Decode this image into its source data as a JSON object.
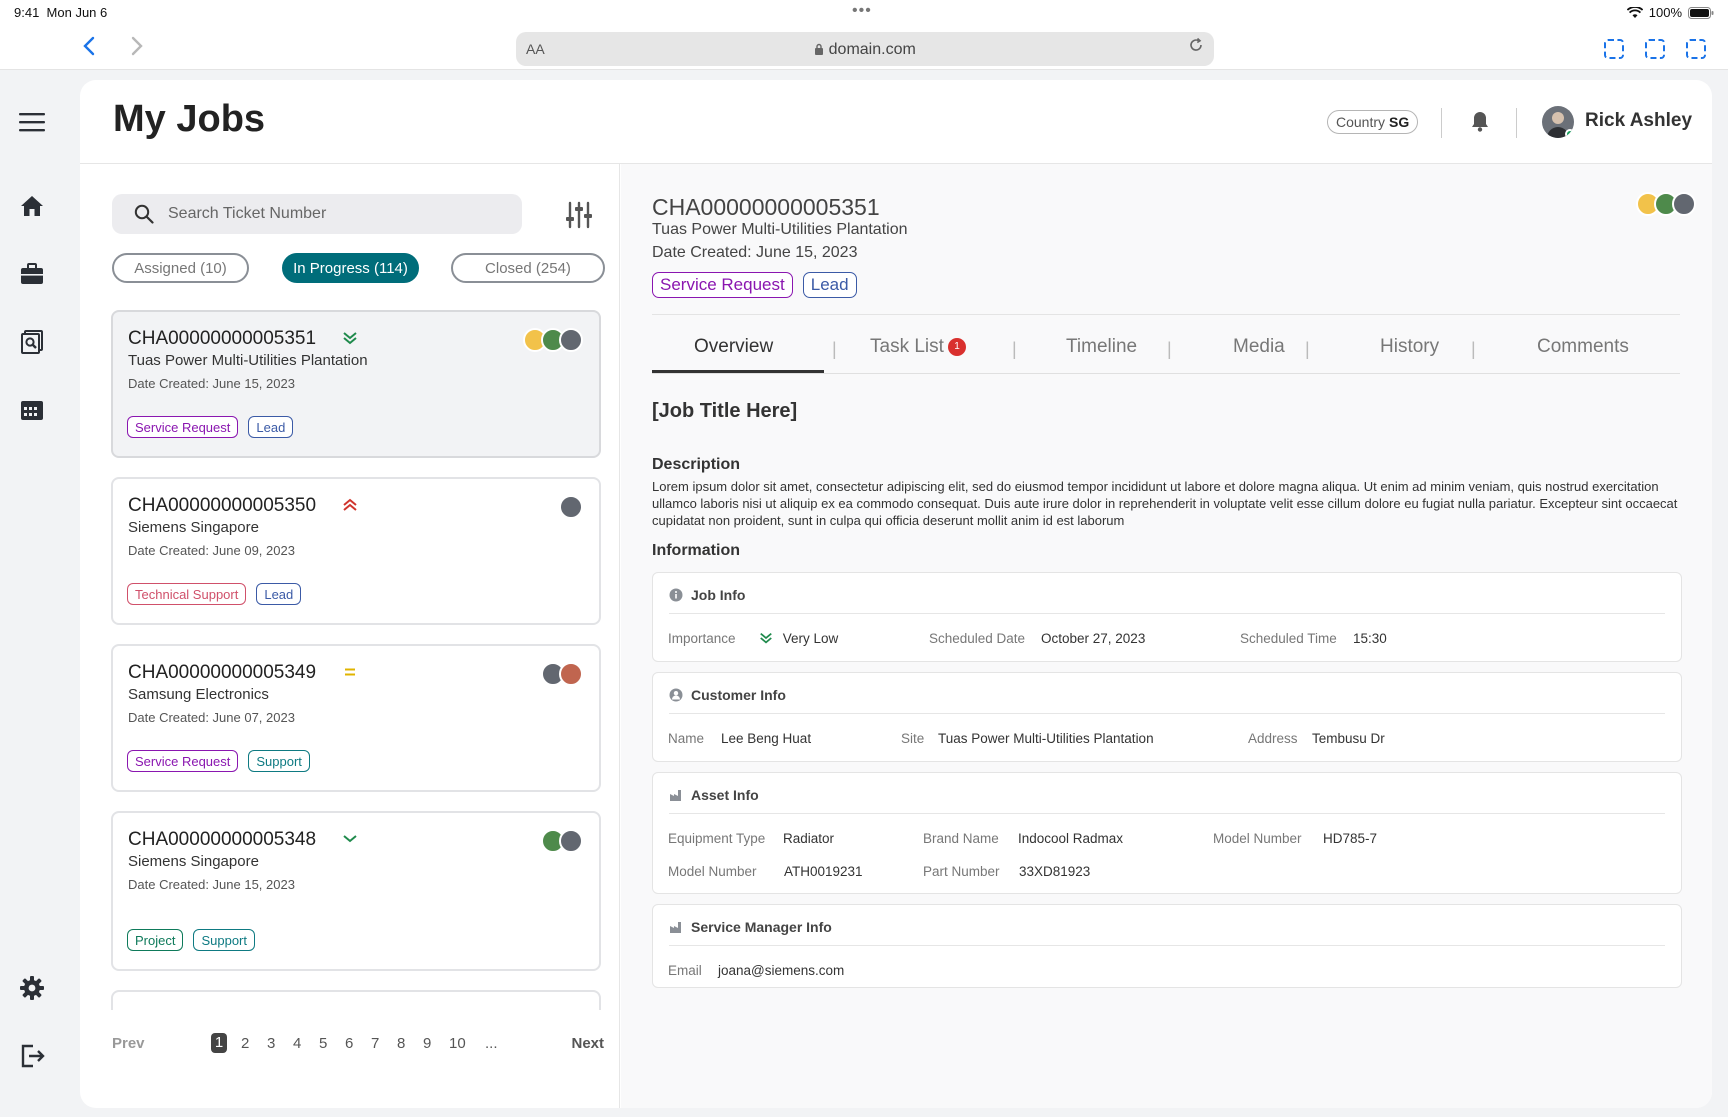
{
  "statusbar": {
    "time": "9:41",
    "date": "Mon Jun 6",
    "battery": "100%"
  },
  "browser": {
    "aa": "AA",
    "url": "domain.com"
  },
  "header": {
    "title": "My Jobs",
    "country_label": "Country",
    "country_value": "SG",
    "user_name": "Rick Ashley"
  },
  "search": {
    "placeholder": "Search Ticket Number"
  },
  "filters": [
    {
      "label": "Assigned (10)"
    },
    {
      "label": "In Progress (114)"
    },
    {
      "label": "Closed (254)"
    }
  ],
  "jobs": [
    {
      "id": "CHA00000000005351",
      "priority": "very-low",
      "company": "Tuas Power Multi-Utilities Plantation",
      "date": "Date Created: June 15, 2023",
      "tags": [
        "Service Request",
        "Lead"
      ]
    },
    {
      "id": "CHA00000000005350",
      "priority": "very-high",
      "company": "Siemens Singapore",
      "date": "Date Created: June 09, 2023",
      "tags": [
        "Technical Support",
        "Lead"
      ]
    },
    {
      "id": "CHA00000000005349",
      "priority": "medium",
      "company": "Samsung Electronics",
      "date": "Date Created: June 07, 2023",
      "tags": [
        "Service Request",
        "Support"
      ]
    },
    {
      "id": "CHA00000000005348",
      "priority": "low",
      "company": "Siemens Singapore",
      "date": "Date Created: June 15, 2023",
      "tags": [
        "Project",
        "Support"
      ]
    }
  ],
  "pagination": {
    "prev": "Prev",
    "next": "Next",
    "pages": [
      "1",
      "2",
      "3",
      "4",
      "5",
      "6",
      "7",
      "8",
      "9",
      "10",
      "..."
    ],
    "current": "1"
  },
  "detail": {
    "id": "CHA00000000005351",
    "company": "Tuas Power Multi-Utilities Plantation",
    "date": "Date Created: June 15, 2023",
    "tags": [
      "Service Request",
      "Lead"
    ],
    "tabs": [
      "Overview",
      "Task List",
      "Timeline",
      "Media",
      "History",
      "Comments"
    ],
    "task_badge": "1",
    "job_title": "[Job Title Here]",
    "description_heading": "Description",
    "description": "Lorem ipsum dolor sit amet, consectetur adipiscing elit, sed do eiusmod tempor incididunt ut labore et dolore magna aliqua. Ut enim ad minim veniam, quis nostrud exercitation ullamco laboris nisi ut aliquip ex ea commodo consequat. Duis aute irure dolor in reprehenderit in voluptate velit esse cillum dolore eu fugiat nulla pariatur. Excepteur sint occaecat cupidatat non proident, sunt in culpa qui officia deserunt mollit anim id est laborum",
    "information_heading": "Information",
    "job_info": {
      "heading": "Job Info",
      "importance_label": "Importance",
      "importance_value": "Very Low",
      "sched_date_label": "Scheduled Date",
      "sched_date_value": "October 27, 2023",
      "sched_time_label": "Scheduled Time",
      "sched_time_value": "15:30"
    },
    "customer_info": {
      "heading": "Customer Info",
      "name_label": "Name",
      "name_value": "Lee Beng Huat",
      "site_label": "Site",
      "site_value": "Tuas Power Multi-Utilities Plantation",
      "address_label": "Address",
      "address_value": "Tembusu Dr"
    },
    "asset_info": {
      "heading": "Asset Info",
      "equip_label": "Equipment Type",
      "equip_value": "Radiator",
      "brand_label": "Brand Name",
      "brand_value": "Indocool Radmax",
      "model1_label": "Model Number",
      "model1_value": "HD785-7",
      "model2_label": "Model Number",
      "model2_value": "ATH0019231",
      "part_label": "Part Number",
      "part_value": "33XD81923"
    },
    "manager_info": {
      "heading": "Service Manager Info",
      "email_label": "Email",
      "email_value": "joana@siemens.com"
    }
  },
  "colors": {
    "accent": "#006d7a",
    "service_request": "#8a16b0",
    "lead": "#3b5aa6",
    "technical_support": "#d0506a",
    "support": "#0e7a82",
    "project": "#0e7a5a",
    "badge": "#d9302e"
  }
}
